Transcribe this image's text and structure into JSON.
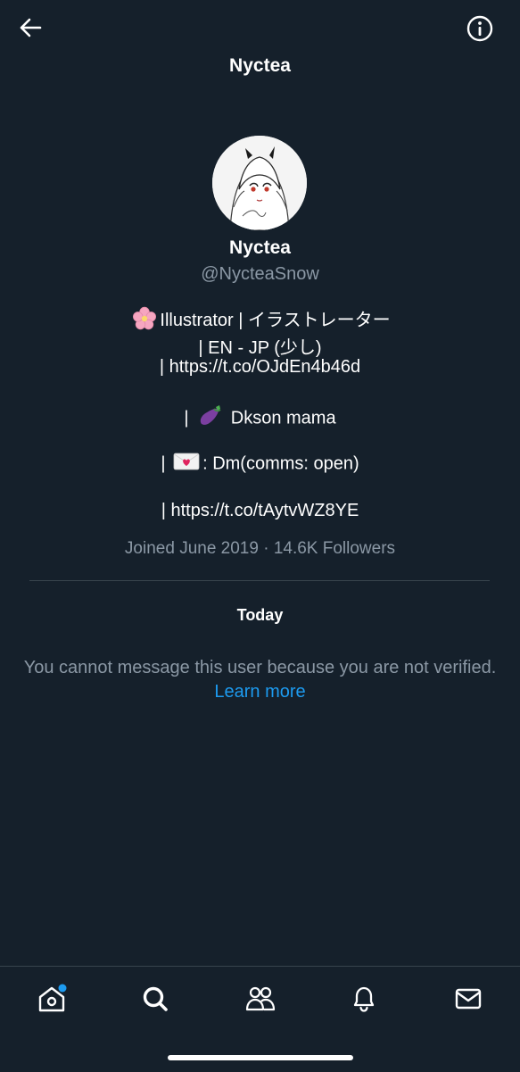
{
  "header": {
    "title": "Nyctea",
    "back_icon": "arrow-left-icon",
    "info_icon": "info-circle-icon"
  },
  "profile": {
    "display_name": "Nyctea",
    "handle": "@NycteaSnow",
    "bio": {
      "line1_text": "Illustrator | イラストレーター",
      "line1_emoji": "cherry-blossom-icon",
      "line2": "| EN - JP (少し)",
      "line3": "| https://t.co/OJdEn4b46d",
      "line4_prefix": "|",
      "line4_emoji": "eggplant-icon",
      "line4_text": "Dkson mama",
      "line5_prefix": "|",
      "line5_emoji": "love-letter-icon",
      "line5_text": ":  Dm(comms: open)",
      "line6": "| https://t.co/tAytvWZ8YE"
    },
    "meta": "Joined June 2019 · 14.6K Followers"
  },
  "conversation": {
    "day_label": "Today",
    "notice_text": "You cannot message this user because you are not verified.",
    "learn_more": "Learn more"
  },
  "bottom_nav": {
    "items": [
      {
        "icon": "home-icon",
        "has_badge": true
      },
      {
        "icon": "search-icon"
      },
      {
        "icon": "communities-icon"
      },
      {
        "icon": "bell-icon"
      },
      {
        "icon": "mail-icon"
      }
    ],
    "badge_color": "#1d9bf0"
  },
  "colors": {
    "background": "#15202b",
    "secondary_text": "#8b98a5",
    "link": "#1d9bf0",
    "divider": "#38444d"
  }
}
